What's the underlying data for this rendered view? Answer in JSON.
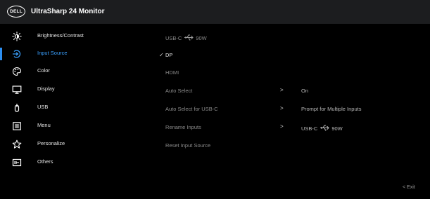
{
  "header": {
    "logo_text": "DELL",
    "title": "UltraSharp 24 Monitor"
  },
  "sidebar": {
    "items": [
      {
        "label": "Brightness/Contrast",
        "icon": "sun-icon"
      },
      {
        "label": "Input Source",
        "icon": "input-source-icon",
        "active": true
      },
      {
        "label": "Color",
        "icon": "palette-icon"
      },
      {
        "label": "Display",
        "icon": "monitor-icon"
      },
      {
        "label": "USB",
        "icon": "usb-icon"
      },
      {
        "label": "Menu",
        "icon": "menu-icon"
      },
      {
        "label": "Personalize",
        "icon": "star-icon"
      },
      {
        "label": "Others",
        "icon": "others-icon"
      }
    ]
  },
  "panel": {
    "options": [
      {
        "label": "USB-C",
        "suffix": "90W",
        "icon": "usb-c-power-icon",
        "selected": false
      },
      {
        "label": "DP",
        "selected": true,
        "check": "✓"
      },
      {
        "label": "HDMI",
        "selected": false
      },
      {
        "label": "Auto Select",
        "chevron": ">",
        "value": "On"
      },
      {
        "label": "Auto Select for USB-C",
        "chevron": ">",
        "value": "Prompt for Multiple Inputs"
      },
      {
        "label": "Rename Inputs",
        "chevron": ">",
        "value": "USB-C",
        "value_suffix": "90W"
      },
      {
        "label": "Reset Input Source"
      }
    ]
  },
  "footer": {
    "exit_label": "< Exit"
  },
  "colors": {
    "accent": "#2c8ef0",
    "titlebar": "#1c1d1f",
    "background": "#000000"
  }
}
